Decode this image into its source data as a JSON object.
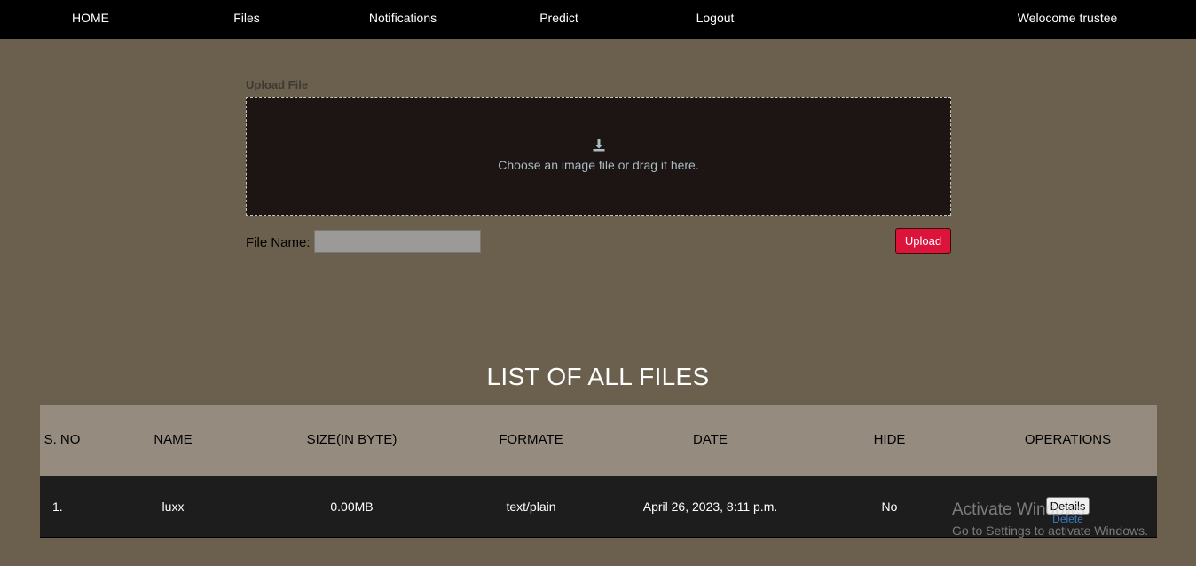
{
  "nav": {
    "items": [
      "HOME",
      "Files",
      "Notifications",
      "Predict",
      "Logout"
    ],
    "welcome": "Welocome trustee"
  },
  "upload": {
    "section_label": "Upload File",
    "dropzone_icon": "download-icon",
    "dropzone_text": "Choose an image file or drag it here.",
    "file_name_label": "File Name:",
    "file_name_value": "",
    "upload_label": "Upload",
    "upload_color": "#dc143c"
  },
  "files": {
    "title": "LIST OF ALL FILES",
    "columns": [
      "S. NO",
      "NAME",
      "SIZE(IN BYTE)",
      "FORMATE",
      "DATE",
      "HIDE",
      "OPERATIONS"
    ],
    "rows": [
      {
        "sno": "1.",
        "name": "luxx",
        "size": "0.00MB",
        "format": "text/plain",
        "date": "April 26, 2023, 8:11 p.m.",
        "hide": "No",
        "details_label": "Details",
        "delete_label": "Delete"
      }
    ]
  },
  "watermark": {
    "title": "Activate Windows",
    "subtitle": "Go to Settings to activate Windows."
  },
  "colors": {
    "page_bg": "#6b604e",
    "nav_bg": "#000000",
    "dropzone_bg": "#1c1514",
    "table_header_bg": "#958b7e",
    "table_row_bg": "#1d1d1d"
  }
}
